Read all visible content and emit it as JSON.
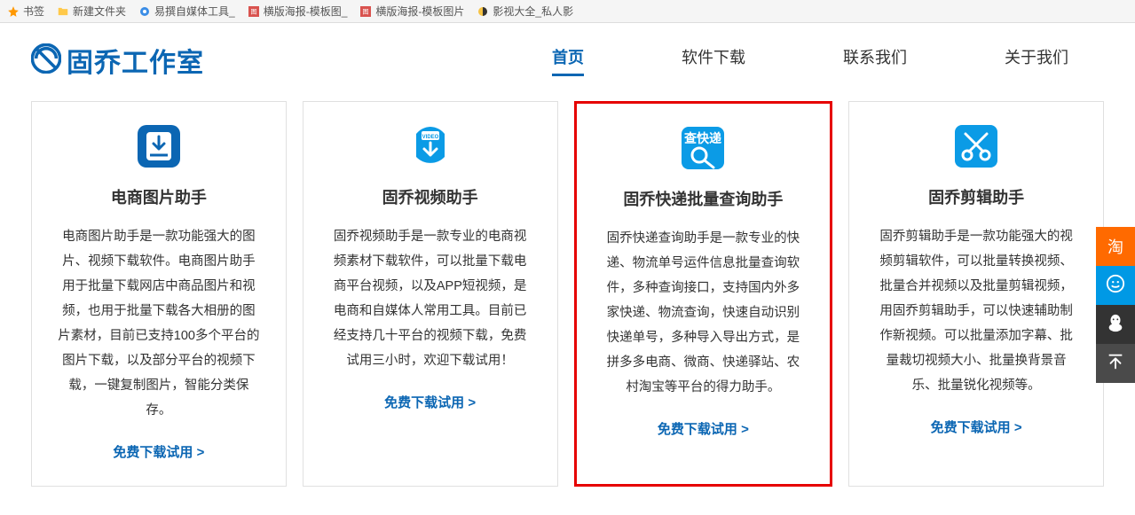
{
  "bookmarks": {
    "items": [
      {
        "label": "书签"
      },
      {
        "label": "新建文件夹"
      },
      {
        "label": "易撰自媒体工具_"
      },
      {
        "label": "横版海报-模板图_"
      },
      {
        "label": "横版海报-模板图片"
      },
      {
        "label": "影视大全_私人影"
      }
    ]
  },
  "site": {
    "brand": "固乔工作室"
  },
  "nav": {
    "items": [
      {
        "label": "首页",
        "active": true
      },
      {
        "label": "软件下载"
      },
      {
        "label": "联系我们"
      },
      {
        "label": "关于我们"
      }
    ]
  },
  "cards": [
    {
      "title": "电商图片助手",
      "desc": "电商图片助手是一款功能强大的图片、视频下载软件。电商图片助手用于批量下载网店中商品图片和视频，也用于批量下载各大相册的图片素材，目前已支持100多个平台的图片下载，以及部分平台的视频下载，一键复制图片，智能分类保存。",
      "link": "免费下载试用 >"
    },
    {
      "title": "固乔视频助手",
      "desc": "固乔视频助手是一款专业的电商视频素材下载软件，可以批量下载电商平台视频，以及APP短视频，是电商和自媒体人常用工具。目前已经支持几十平台的视频下载，免费试用三小时，欢迎下载试用！",
      "link": "免费下载试用 >"
    },
    {
      "title": "固乔快递批量查询助手",
      "desc": "固乔快递查询助手是一款专业的快递、物流单号运件信息批量查询软件，多种查询接口，支持国内外多家快递、物流查询，快速自动识别快递单号，多种导入导出方式，是拼多多电商、微商、快递驿站、农村淘宝等平台的得力助手。",
      "link": "免费下载试用 >"
    },
    {
      "title": "固乔剪辑助手",
      "desc": "固乔剪辑助手是一款功能强大的视频剪辑软件，可以批量转换视频、批量合并视频以及批量剪辑视频，用固乔剪辑助手，可以快速辅助制作新视频。可以批量添加字幕、批量裁切视频大小、批量换背景音乐、批量锐化视频等。",
      "link": "免费下载试用 >"
    }
  ],
  "sidebar": {
    "items": [
      {
        "label": "淘"
      },
      {
        "label": "face"
      },
      {
        "label": "qq"
      },
      {
        "label": "top"
      }
    ]
  }
}
